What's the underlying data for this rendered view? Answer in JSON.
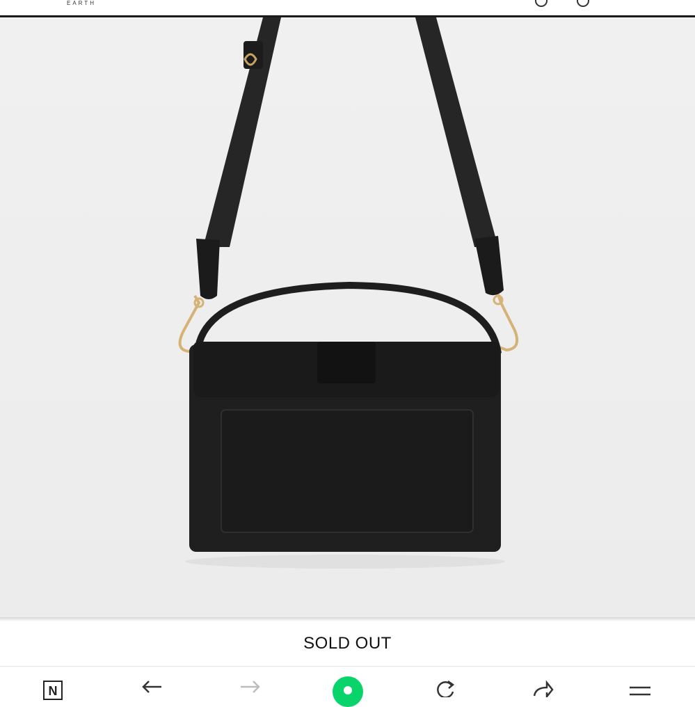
{
  "header": {
    "brand_subtitle": "EARTH"
  },
  "product": {
    "status_label": "SOLD OUT",
    "image_name": "black-crossbody-bag"
  },
  "browser_bar": {
    "logo_letter": "N",
    "buttons": [
      "back-icon",
      "forward-icon",
      "home-icon",
      "reload-icon",
      "share-icon",
      "menu-icon"
    ]
  },
  "colors": {
    "background": "#efefef",
    "bag": "#1f1f1f",
    "strap": "#2b2b2b",
    "hardware": "#d8b878",
    "accent": "#09d46c"
  }
}
